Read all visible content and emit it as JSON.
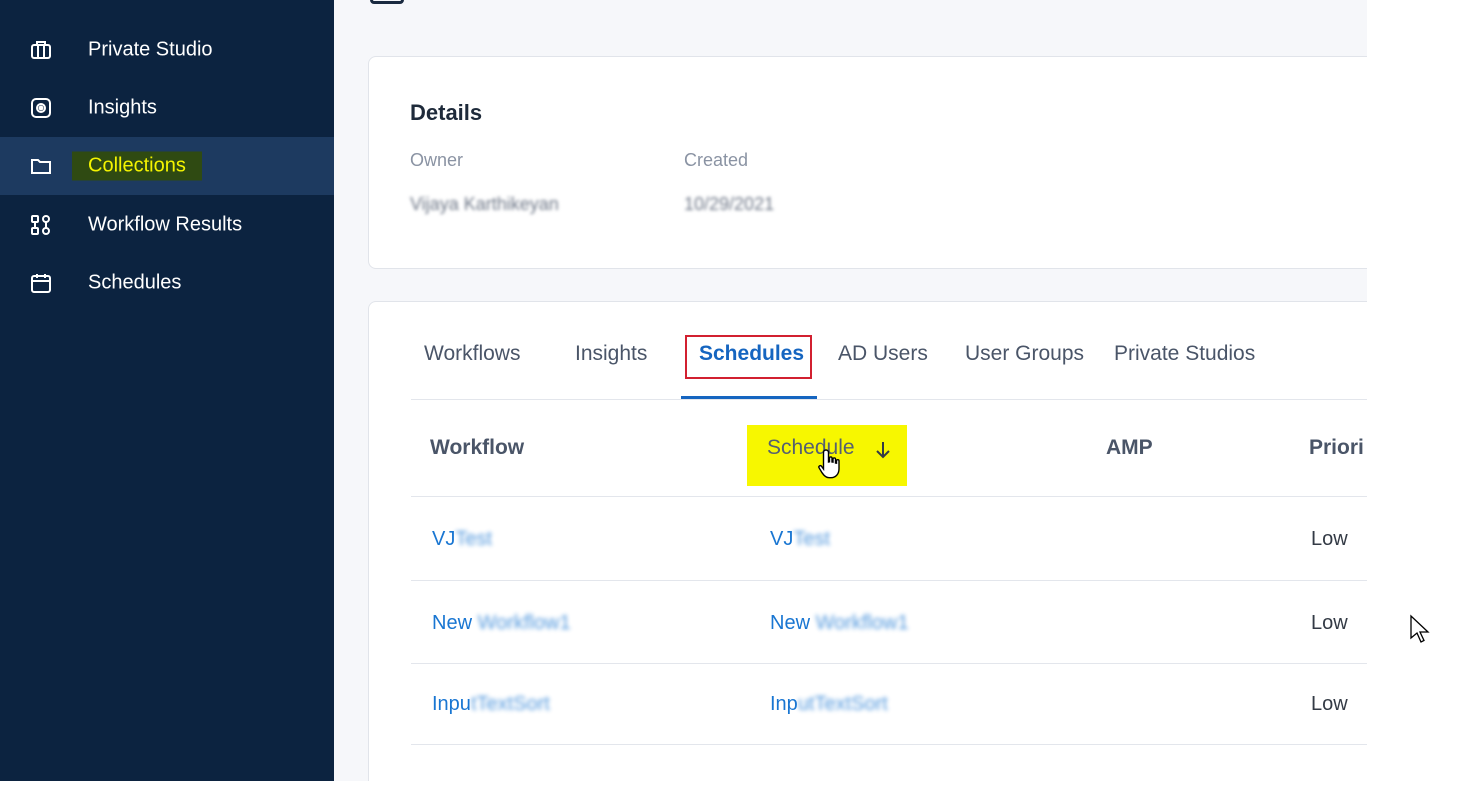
{
  "sidebar": {
    "items": [
      {
        "label": "Private Studio",
        "icon": "briefcase-icon"
      },
      {
        "label": "Insights",
        "icon": "eye-icon"
      },
      {
        "label": "Collections",
        "icon": "folder-icon",
        "active": true
      },
      {
        "label": "Workflow Results",
        "icon": "workflow-icon"
      },
      {
        "label": "Schedules",
        "icon": "calendar-icon"
      }
    ]
  },
  "details": {
    "title": "Details",
    "owner_label": "Owner",
    "owner_value": "Vijaya Karthikeyan",
    "created_label": "Created",
    "created_value": "10/29/2021"
  },
  "tabs": [
    {
      "label": "Workflows"
    },
    {
      "label": "Insights"
    },
    {
      "label": "Schedules",
      "active": true
    },
    {
      "label": "AD Users"
    },
    {
      "label": "User Groups"
    },
    {
      "label": "Private Studios"
    }
  ],
  "table": {
    "columns": [
      "Workflow",
      "Schedule",
      "AMP",
      "Priori"
    ],
    "sort_column": "Schedule",
    "sort_direction": "descending",
    "rows": [
      {
        "workflow": [
          "VJ",
          "Test"
        ],
        "schedule": [
          "VJ",
          "Test"
        ],
        "amp": "",
        "priority": "Low"
      },
      {
        "workflow": [
          "New",
          " Workflow1"
        ],
        "schedule": [
          "New",
          " Workflow1"
        ],
        "amp": "",
        "priority": "Low"
      },
      {
        "workflow": [
          "Inpu",
          "tTextSort"
        ],
        "schedule": [
          "Inp",
          "utTextSort"
        ],
        "amp": "",
        "priority": "Low"
      }
    ]
  },
  "colors": {
    "sidebar_bg": "#0c2340",
    "active_nav_bg": "#1d3a60",
    "accent_blue": "#1565c0",
    "link_blue": "#1976d2",
    "highlight_yellow": "#f7f700",
    "tab_box_red": "#d22030"
  }
}
